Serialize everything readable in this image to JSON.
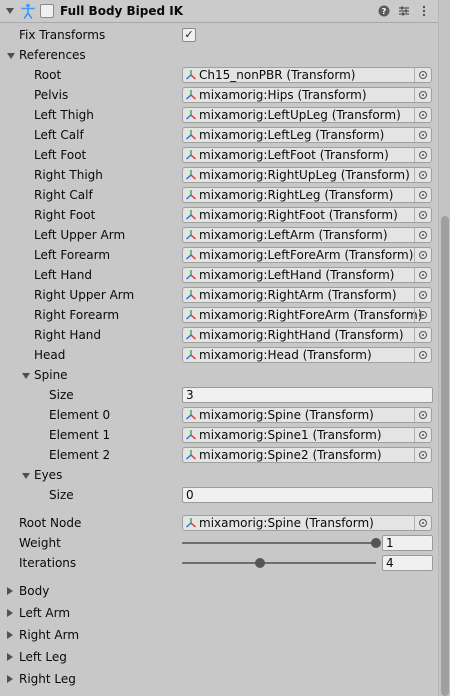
{
  "component": {
    "title": "Full Body Biped IK"
  },
  "fix_transforms": {
    "label": "Fix Transforms",
    "checked": true,
    "check_glyph": "✓"
  },
  "references": {
    "label": "References",
    "items": [
      {
        "label": "Root",
        "value": "Ch15_nonPBR (Transform)"
      },
      {
        "label": "Pelvis",
        "value": "mixamorig:Hips (Transform)"
      },
      {
        "label": "Left Thigh",
        "value": "mixamorig:LeftUpLeg (Transform)"
      },
      {
        "label": "Left Calf",
        "value": "mixamorig:LeftLeg (Transform)"
      },
      {
        "label": "Left Foot",
        "value": "mixamorig:LeftFoot (Transform)"
      },
      {
        "label": "Right Thigh",
        "value": "mixamorig:RightUpLeg (Transform)"
      },
      {
        "label": "Right Calf",
        "value": "mixamorig:RightLeg (Transform)"
      },
      {
        "label": "Right Foot",
        "value": "mixamorig:RightFoot (Transform)"
      },
      {
        "label": "Left Upper Arm",
        "value": "mixamorig:LeftArm (Transform)"
      },
      {
        "label": "Left Forearm",
        "value": "mixamorig:LeftForeArm (Transform)"
      },
      {
        "label": "Left Hand",
        "value": "mixamorig:LeftHand (Transform)"
      },
      {
        "label": "Right Upper Arm",
        "value": "mixamorig:RightArm (Transform)"
      },
      {
        "label": "Right Forearm",
        "value": "mixamorig:RightForeArm (Transform)"
      },
      {
        "label": "Right Hand",
        "value": "mixamorig:RightHand (Transform)"
      },
      {
        "label": "Head",
        "value": "mixamorig:Head (Transform)"
      }
    ],
    "spine": {
      "label": "Spine",
      "size_label": "Size",
      "size_value": "3",
      "elements": [
        {
          "label": "Element 0",
          "value": "mixamorig:Spine (Transform)"
        },
        {
          "label": "Element 1",
          "value": "mixamorig:Spine1 (Transform)"
        },
        {
          "label": "Element 2",
          "value": "mixamorig:Spine2 (Transform)"
        }
      ]
    },
    "eyes": {
      "label": "Eyes",
      "size_label": "Size",
      "size_value": "0"
    }
  },
  "root_node": {
    "label": "Root Node",
    "value": "mixamorig:Spine (Transform)"
  },
  "weight": {
    "label": "Weight",
    "value": "1",
    "level": 1.0
  },
  "iterations": {
    "label": "Iterations",
    "value": "4",
    "level": 0.4
  },
  "sections": [
    "Body",
    "Left Arm",
    "Right Arm",
    "Left Leg",
    "Right Leg"
  ],
  "icons": {
    "component": "ik-figure-icon",
    "transform": "transform-axes-icon",
    "help": "help-icon",
    "presets": "presets-icon",
    "menu": "kebab-menu-icon"
  },
  "colors": {
    "accent": "#3c96ff",
    "axis_red": "#d8352a",
    "axis_green": "#3aa336",
    "axis_blue": "#2a6fd8"
  }
}
